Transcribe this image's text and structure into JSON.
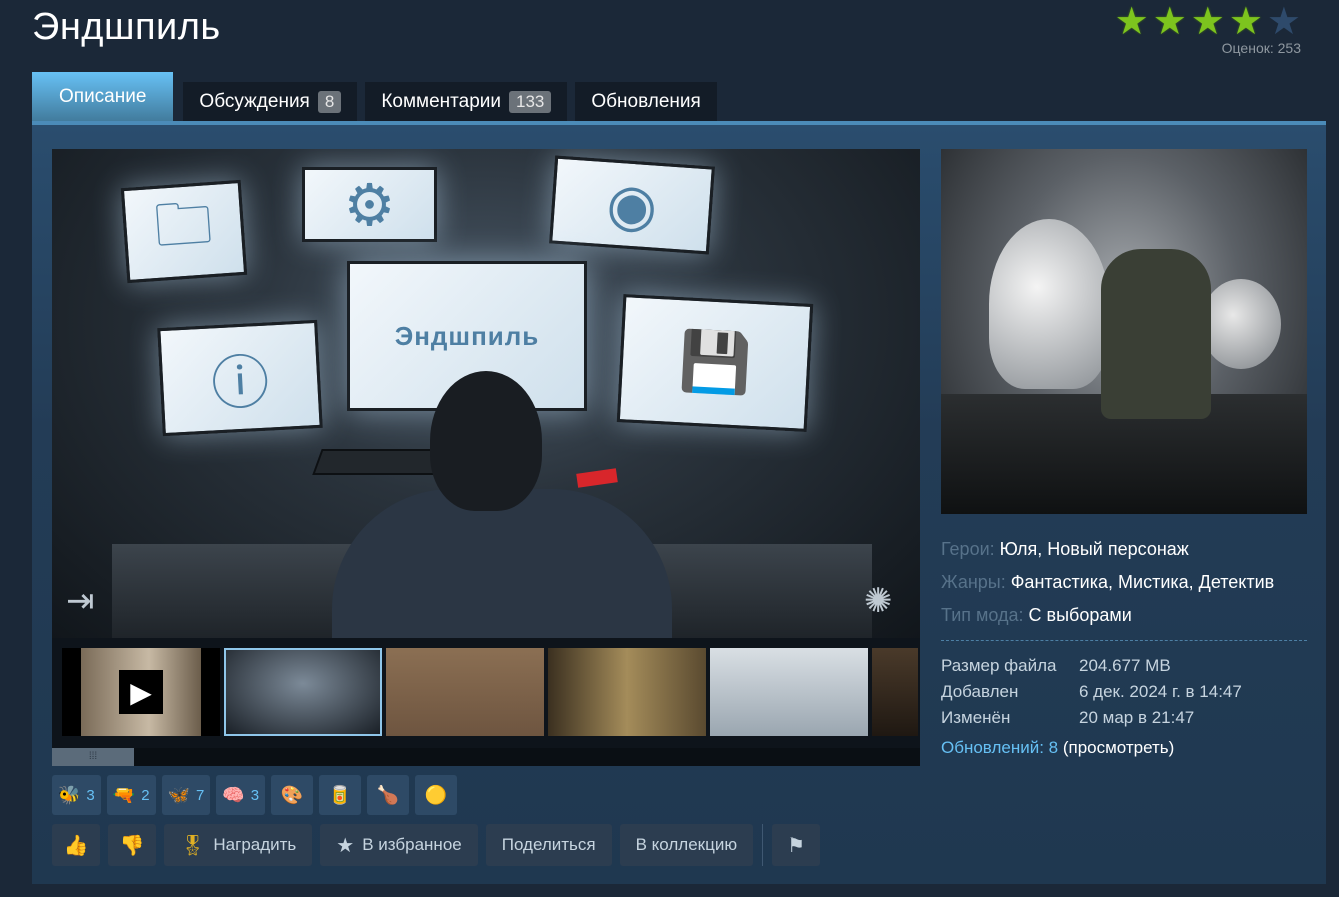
{
  "header": {
    "title": "Эндшпиль",
    "rating_stars_filled": 4,
    "rating_stars_total": 5,
    "rating_count_text": "Оценок: 253"
  },
  "tabs": [
    {
      "label": "Описание",
      "count": null,
      "active": true
    },
    {
      "label": "Обсуждения",
      "count": "8",
      "active": false
    },
    {
      "label": "Комментарии",
      "count": "133",
      "active": false
    },
    {
      "label": "Обновления",
      "count": null,
      "active": false
    }
  ],
  "main_shot": {
    "center_text": "Эндшпиль"
  },
  "tags": {
    "heroes_label": "Герои:",
    "heroes": "Юля, Новый персонаж",
    "genres_label": "Жанры:",
    "genres": "Фантастика, Мистика, Детектив",
    "modtype_label": "Тип мода:",
    "modtype": "С выборами"
  },
  "stats": {
    "size_label": "Размер файла",
    "size_value": "204.677 MB",
    "added_label": "Добавлен",
    "added_value": "6 дек. 2024 г. в 14:47",
    "changed_label": "Изменён",
    "changed_value": "20 мар в 21:47",
    "updates_link": "Обновлений: 8",
    "updates_view": "(просмотреть)"
  },
  "awards": [
    {
      "icon": "🐝",
      "count": "3"
    },
    {
      "icon": "🔫",
      "count": "2"
    },
    {
      "icon": "🦋",
      "count": "7"
    },
    {
      "icon": "🧠",
      "count": "3"
    },
    {
      "icon": "🎨",
      "count": ""
    },
    {
      "icon": "🥫",
      "count": ""
    },
    {
      "icon": "🍗",
      "count": ""
    },
    {
      "icon": "🟡",
      "count": ""
    }
  ],
  "actions": {
    "award_label": "Наградить",
    "favorite_label": "В избранное",
    "share_label": "Поделиться",
    "collection_label": "В коллекцию"
  },
  "colors": {
    "background": "#1b2838",
    "accent_blue": "#66c0f4",
    "star_on": "#7dc41e"
  }
}
